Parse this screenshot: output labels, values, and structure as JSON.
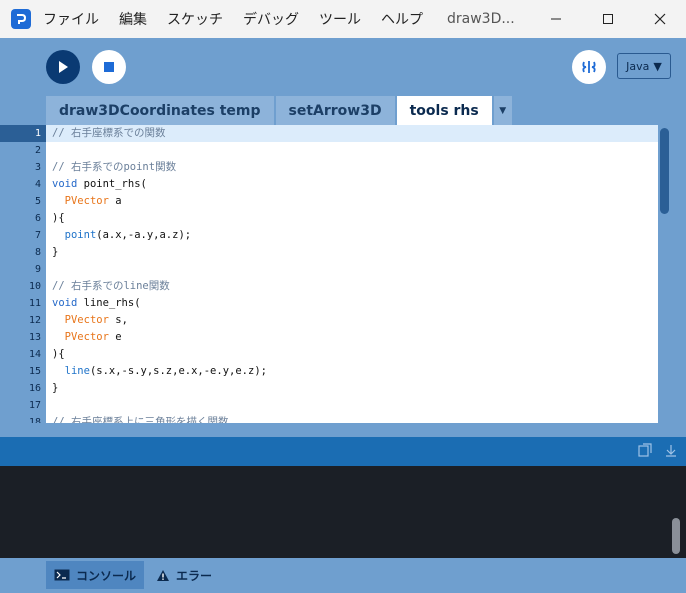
{
  "menu": {
    "items": [
      "ファイル",
      "編集",
      "スケッチ",
      "デバッグ",
      "ツール",
      "ヘルプ"
    ],
    "window_title": "draw3D..."
  },
  "toolbar": {
    "mode_label": "Java",
    "mode_caret": "▼"
  },
  "tabs": [
    "draw3DCoordinates temp",
    "setArrow3D",
    "tools rhs"
  ],
  "tab_more": "▼",
  "editor": {
    "current_line": 1,
    "lines": [
      {
        "n": "1",
        "tokens": [
          {
            "t": "// 右手座標系での関数",
            "c": "cm"
          }
        ]
      },
      {
        "n": "2",
        "tokens": []
      },
      {
        "n": "3",
        "tokens": [
          {
            "t": "// 右手系でのpoint関数",
            "c": "cm"
          }
        ]
      },
      {
        "n": "4",
        "tokens": [
          {
            "t": "void",
            "c": "kw"
          },
          {
            "t": " point_rhs(",
            "c": ""
          }
        ]
      },
      {
        "n": "5",
        "tokens": [
          {
            "t": "  ",
            "c": ""
          },
          {
            "t": "PVector",
            "c": "ty"
          },
          {
            "t": " a",
            "c": ""
          }
        ]
      },
      {
        "n": "6",
        "tokens": [
          {
            "t": "){",
            "c": ""
          }
        ]
      },
      {
        "n": "7",
        "tokens": [
          {
            "t": "  ",
            "c": ""
          },
          {
            "t": "point",
            "c": "fn"
          },
          {
            "t": "(a.x,-a.y,a.z);",
            "c": ""
          }
        ]
      },
      {
        "n": "8",
        "tokens": [
          {
            "t": "}",
            "c": ""
          }
        ]
      },
      {
        "n": "9",
        "tokens": []
      },
      {
        "n": "10",
        "tokens": [
          {
            "t": "// 右手系でのline関数",
            "c": "cm"
          }
        ]
      },
      {
        "n": "11",
        "tokens": [
          {
            "t": "void",
            "c": "kw"
          },
          {
            "t": " line_rhs(",
            "c": ""
          }
        ]
      },
      {
        "n": "12",
        "tokens": [
          {
            "t": "  ",
            "c": ""
          },
          {
            "t": "PVector",
            "c": "ty"
          },
          {
            "t": " s,",
            "c": ""
          }
        ]
      },
      {
        "n": "13",
        "tokens": [
          {
            "t": "  ",
            "c": ""
          },
          {
            "t": "PVector",
            "c": "ty"
          },
          {
            "t": " e",
            "c": ""
          }
        ]
      },
      {
        "n": "14",
        "tokens": [
          {
            "t": "){",
            "c": ""
          }
        ]
      },
      {
        "n": "15",
        "tokens": [
          {
            "t": "  ",
            "c": ""
          },
          {
            "t": "line",
            "c": "fn"
          },
          {
            "t": "(s.x,-s.y,s.z,e.x,-e.y,e.z);",
            "c": ""
          }
        ]
      },
      {
        "n": "16",
        "tokens": [
          {
            "t": "}",
            "c": ""
          }
        ]
      },
      {
        "n": "17",
        "tokens": []
      },
      {
        "n": "18",
        "tokens": [
          {
            "t": "// 右手座標系上に三角形を描く関数",
            "c": "cm"
          }
        ]
      }
    ]
  },
  "bottom_tabs": {
    "console": "コンソール",
    "errors": "エラー"
  },
  "colors": {
    "accent": "#6f9fcf",
    "console_bg": "#1b1f26",
    "status_bar": "#1b6db3"
  }
}
